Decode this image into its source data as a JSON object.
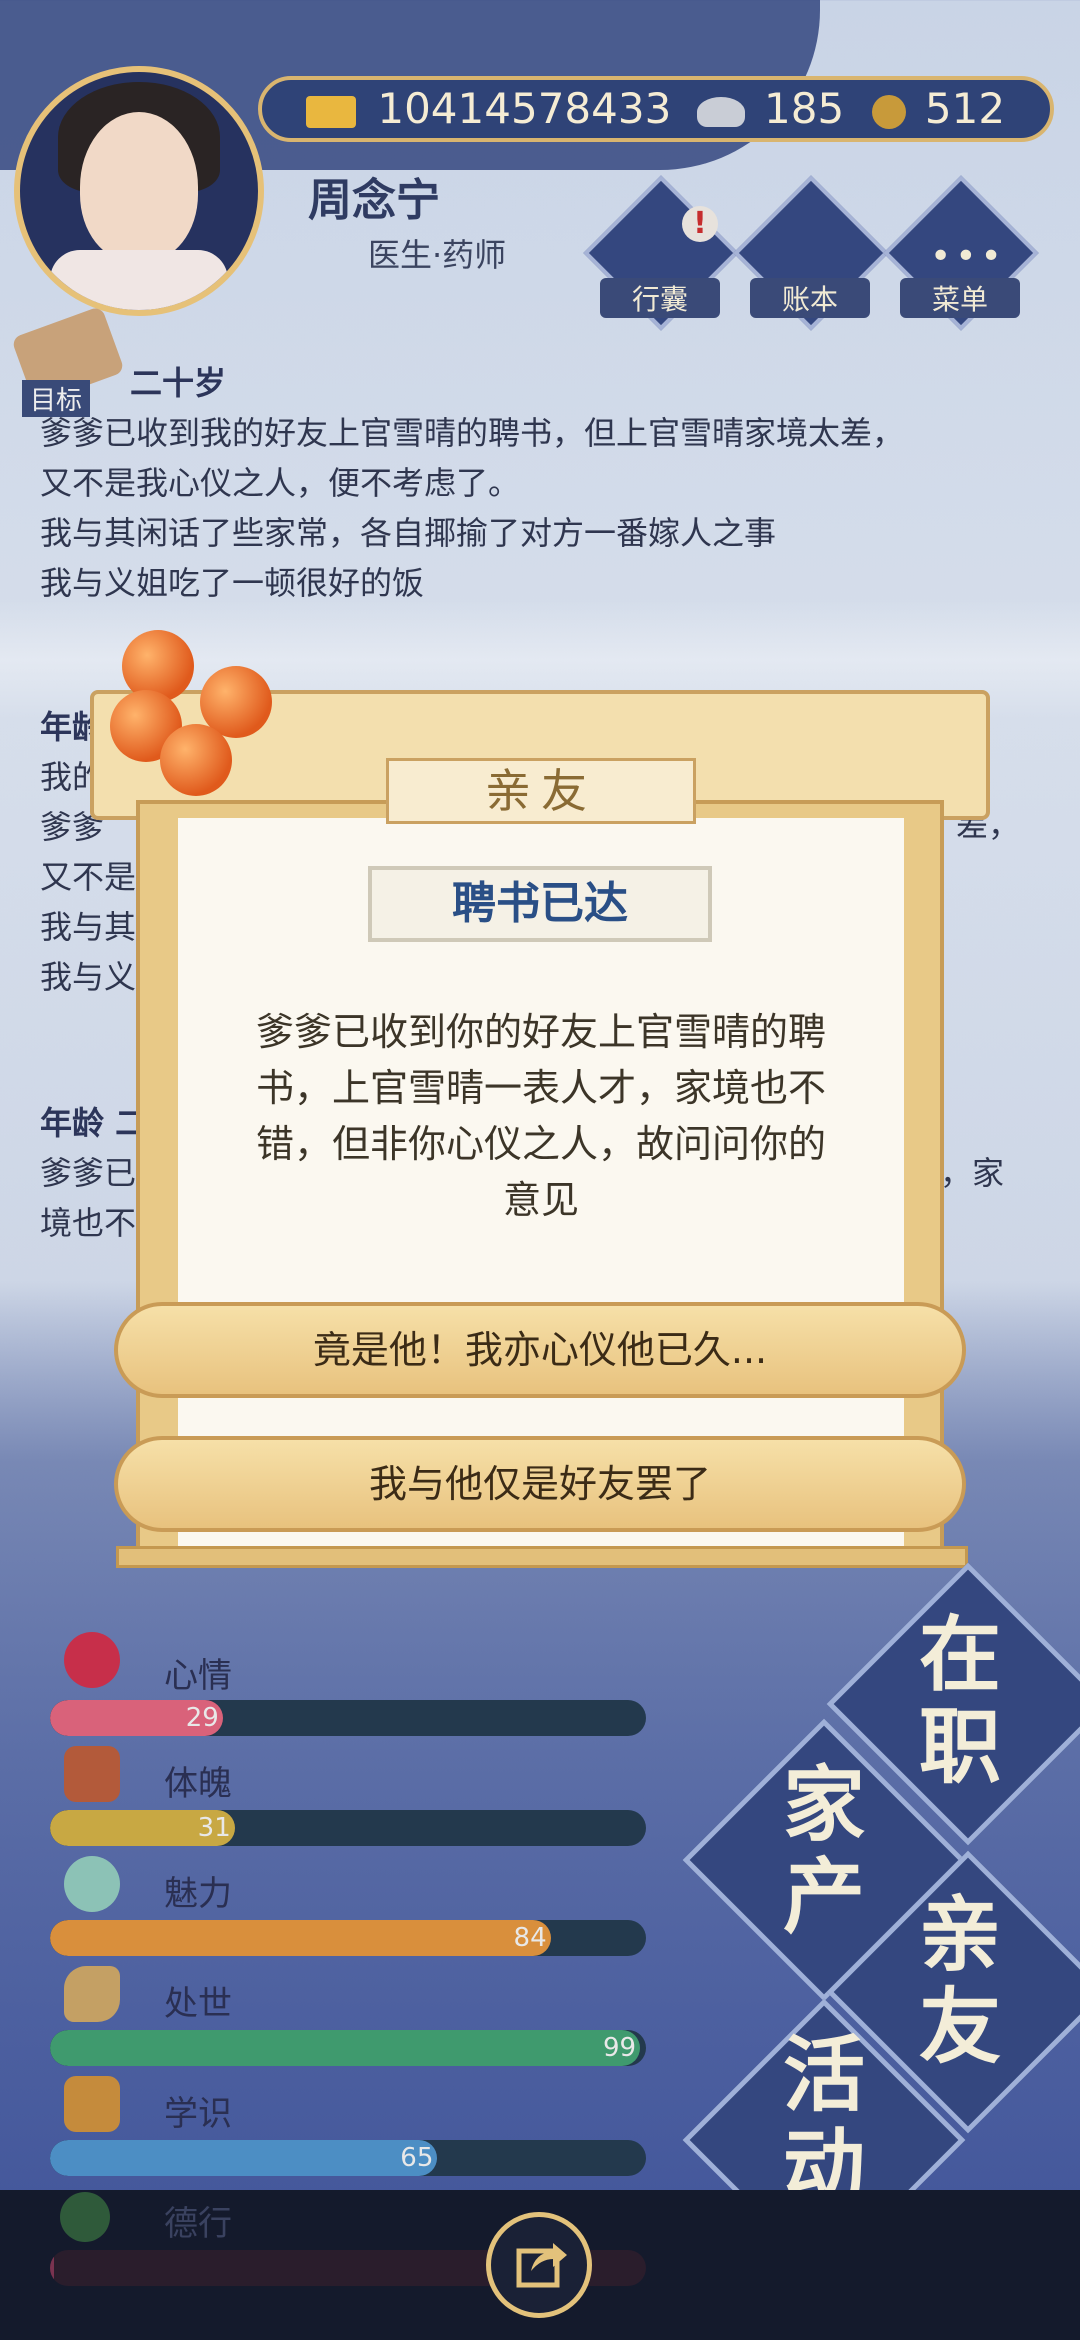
{
  "player": {
    "name": "周念宁",
    "title": "医生·药师",
    "gold": "10414578433",
    "silver": "185",
    "coin": "512"
  },
  "quick_menu": {
    "bag": "行囊",
    "ledger": "账本",
    "menu": "菜单",
    "target": "目标"
  },
  "log": [
    {
      "age": "二十岁",
      "lines": [
        "爹爹已收到我的好友上官雪晴的聘书，但上官雪晴家境太差，",
        "又不是我心仪之人，便不考虑了。",
        "我与其闲话了些家常，各自揶揄了对方一番嫁人之事",
        "我与义姐吃了一顿很好的饭"
      ]
    },
    {
      "age": "年龄",
      "lines": [
        "我的",
        "爹爹",
        "差，",
        "又不是",
        "我与其",
        "我与义"
      ]
    },
    {
      "age": "年龄 二",
      "lines": [
        "爹爹已",
        "，家",
        "境也不"
      ]
    }
  ],
  "popup": {
    "tab": "亲友",
    "title": "聘书已达",
    "body": [
      "爹爹已收到你的好友上官雪晴的聘",
      "书，上官雪晴一表人才，家境也不",
      "错，但非你心仪之人，故问问你的",
      "意见"
    ],
    "choices": [
      "竟是他！我亦心仪他已久...",
      "我与他仅是好友罢了"
    ]
  },
  "stats": [
    {
      "name": "心情",
      "value": 29,
      "color": "#d9627a"
    },
    {
      "name": "体魄",
      "value": 31,
      "color": "#c8a843"
    },
    {
      "name": "魅力",
      "value": 84,
      "color": "#d98f3c"
    },
    {
      "name": "处世",
      "value": 99,
      "color": "#3f9a6e"
    },
    {
      "name": "学识",
      "value": 65,
      "color": "#4c8ec4"
    },
    {
      "name": "德行",
      "value": 0,
      "color": "#7a3350"
    }
  ],
  "sections": [
    "在职",
    "家产",
    "亲友",
    "活动"
  ]
}
